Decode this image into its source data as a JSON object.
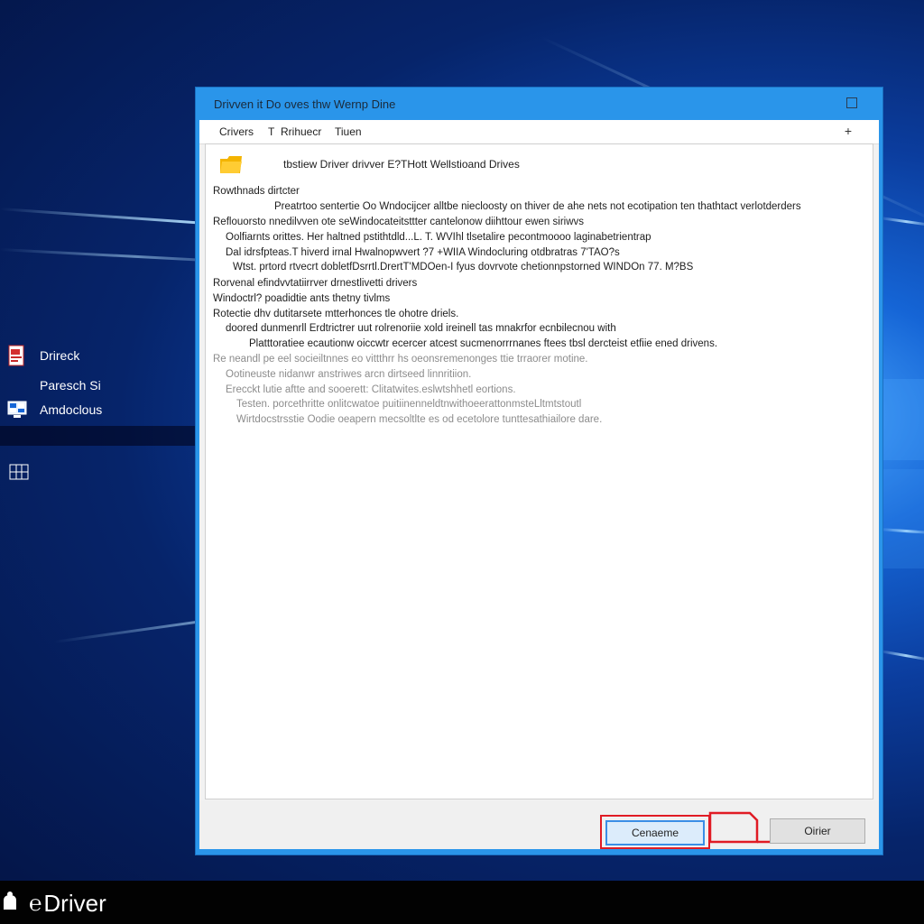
{
  "window": {
    "title": "Drivven it Do oves thw Wernp Dine",
    "menu": [
      "Crivers",
      "T",
      "Rrihuecr",
      "Tiuen"
    ],
    "plus_label": "+"
  },
  "content": {
    "header": "tbstiew Driver drivver E?THott Wellstioand Drives",
    "lines": [
      "Rowthnads dirtcter",
      "Preatrtoo sentertie Oo Wndocijcer alltbe niecloosty on thiver de ahe nets not ecotipation ten thathtact verlotderders",
      "Reflouorsto nnedilvven ote seWindocateitsttter cantelonow diihttour ewen siriwvs",
      "Oolfiarnts orittes. Her haltned pstithtdld...L. T. WVIhl tlsetalire pecontmoooo laginabetrientrap",
      "Dal idrsfpteas.T hiverd irnal Hwalnopwvert ?7 +WIIA Windocluring otdbratras 7'TAO?s",
      "Wtst. prtord rtvecrt  dobletfDsrrtl.DrertT'MDOen-I fyus dovrvote chetionnpstorned WINDOn 77. M?BS",
      "Rorvenal efindvvtatiirrver drnestlivetti drivers",
      "Windoctrl? poadidtie ants thetny tivlms",
      "Rotectie dhv dutitarsete mtterhonces tle ohotre driels.",
      "doored dunmenrll Erdtrictrer uut rolrenoriie xold ireinell tas mnakrfor ecnbilecnou with",
      "Platttoratiee ecautionw oiccwtr ecercer atcest sucmenorrrnanes ftees tbsl dercteist etfiie ened drivens.",
      "Re neandl pe eel socieiltnnes eo vittthrr hs oeonsremenonges ttie trraorer motine.",
      "Ootineuste nidanwr anstriwes arcn dirtseed linnritiion.",
      "Erecckt lutie aftte and sooerett: Clitatwites.eslwtshhetl eortions.",
      "Testen. porcethritte onlitcwatoe puitiinenneldtnwithoeerattonmsteLltmtstoutl",
      "Wirtdocstrsstie Oodie oeapern mecsoltlte es od ecetolore tunttesathiailore dare."
    ],
    "faded_from_index": 11
  },
  "desktop_icons": [
    "Drireck",
    "Paresch Si",
    "Amdoclous"
  ],
  "taskbar": {
    "app_label": "Driver"
  },
  "buttons": {
    "primary": "Cenaeme",
    "secondary": "Oirier"
  },
  "colors": {
    "titlebar": "#2a95ea",
    "primary_border": "#3a8ee6",
    "highlight_red": "#e01b24"
  }
}
